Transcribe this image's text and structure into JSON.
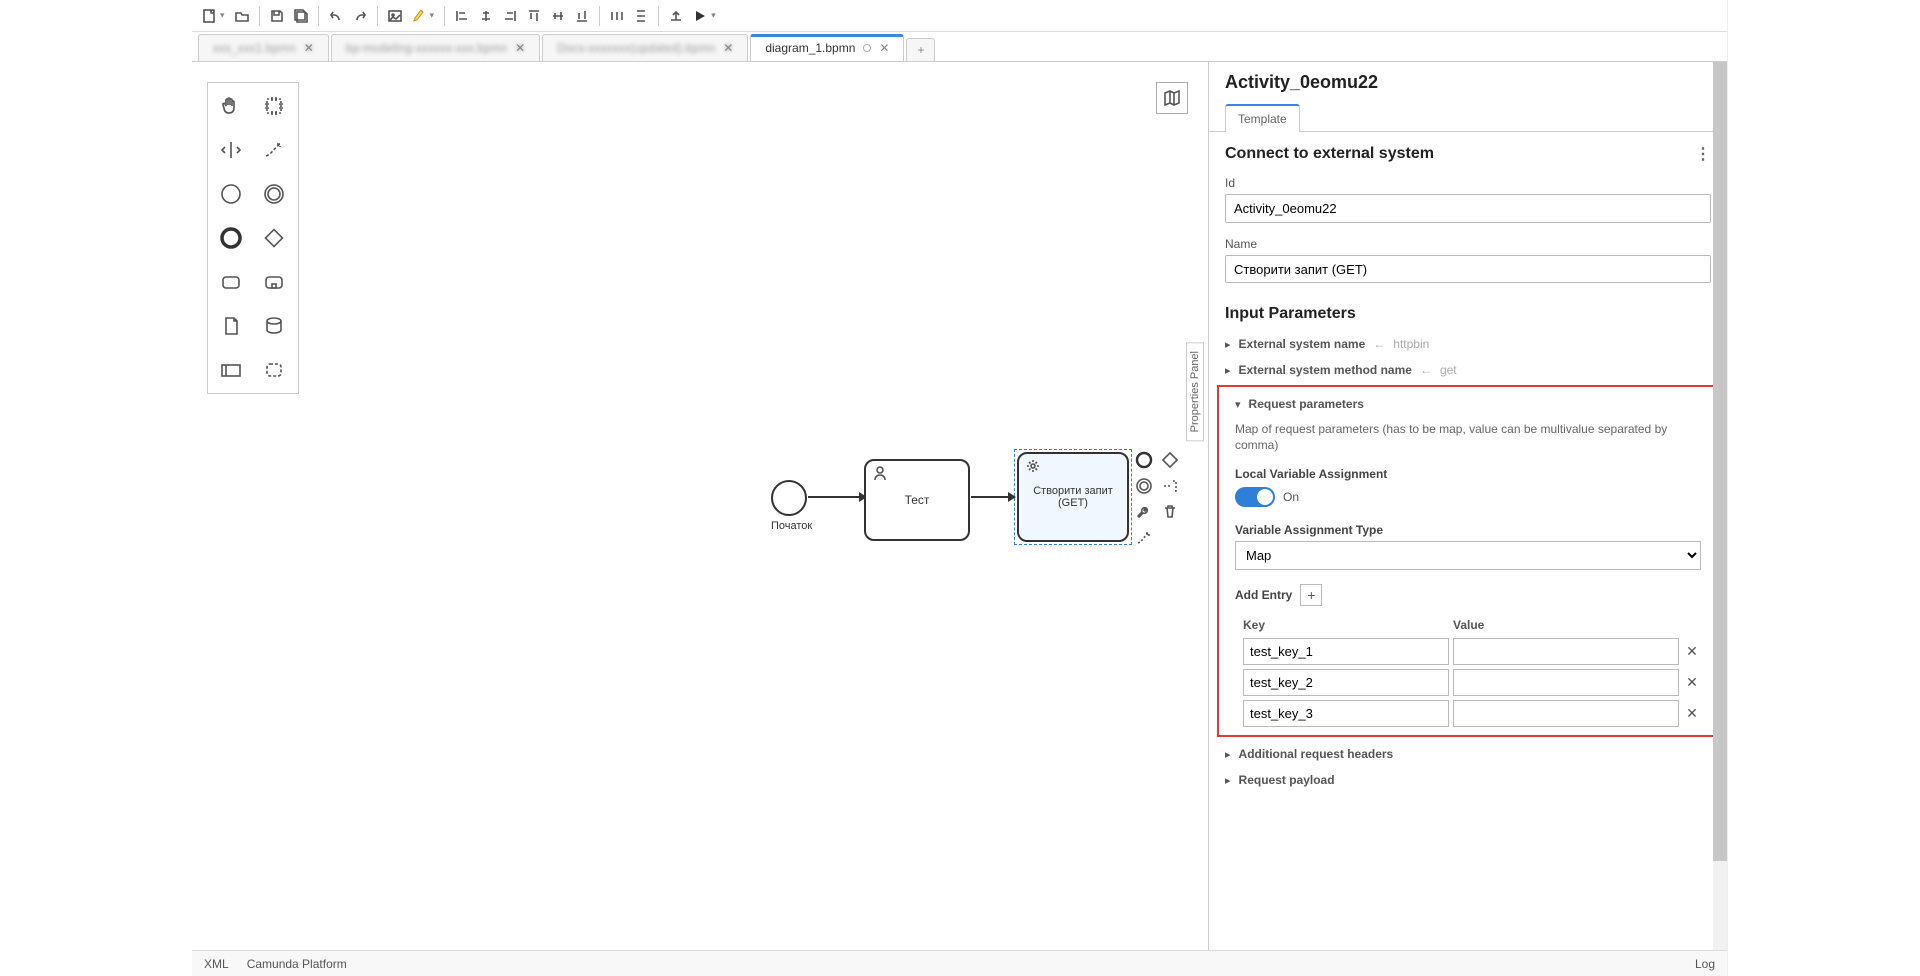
{
  "tabs": {
    "t1": "xxx_xxx1.bpmn",
    "t2": "bp-modeling-xxxxxx-xxx.bpmn",
    "t3": "Docs-xxxxxxx(updated).bpmn",
    "t4": "diagram_1.bpmn",
    "add": "+"
  },
  "canvas": {
    "start_label": "Початок",
    "task1_label": "Тест",
    "task2_line1": "Створити запит",
    "task2_line2": "(GET)",
    "pp_handle": "Properties Panel"
  },
  "panel": {
    "title": "Activity_0eomu22",
    "tab_template": "Template",
    "sec_connect": "Connect to external system",
    "id_label": "Id",
    "id_value": "Activity_0eomu22",
    "name_label": "Name",
    "name_value": "Створити запит (GET)",
    "sec_input": "Input Parameters",
    "ext_name_label": "External system name",
    "ext_name_hint": "httpbin",
    "ext_method_label": "External system method name",
    "ext_method_hint": "get",
    "req_params_label": "Request parameters",
    "req_params_desc": "Map of request parameters (has to be map, value can be multivalue separated by comma)",
    "lva_label": "Local Variable Assignment",
    "lva_state": "On",
    "vat_label": "Variable Assignment Type",
    "vat_value": "Map",
    "add_entry_label": "Add Entry",
    "kv_key_header": "Key",
    "kv_value_header": "Value",
    "entries": [
      "test_key_1",
      "test_key_2",
      "test_key_3"
    ],
    "add_headers_label": "Additional request headers",
    "req_payload_label": "Request payload"
  },
  "footer": {
    "xml": "XML",
    "platform": "Camunda Platform",
    "log": "Log"
  }
}
